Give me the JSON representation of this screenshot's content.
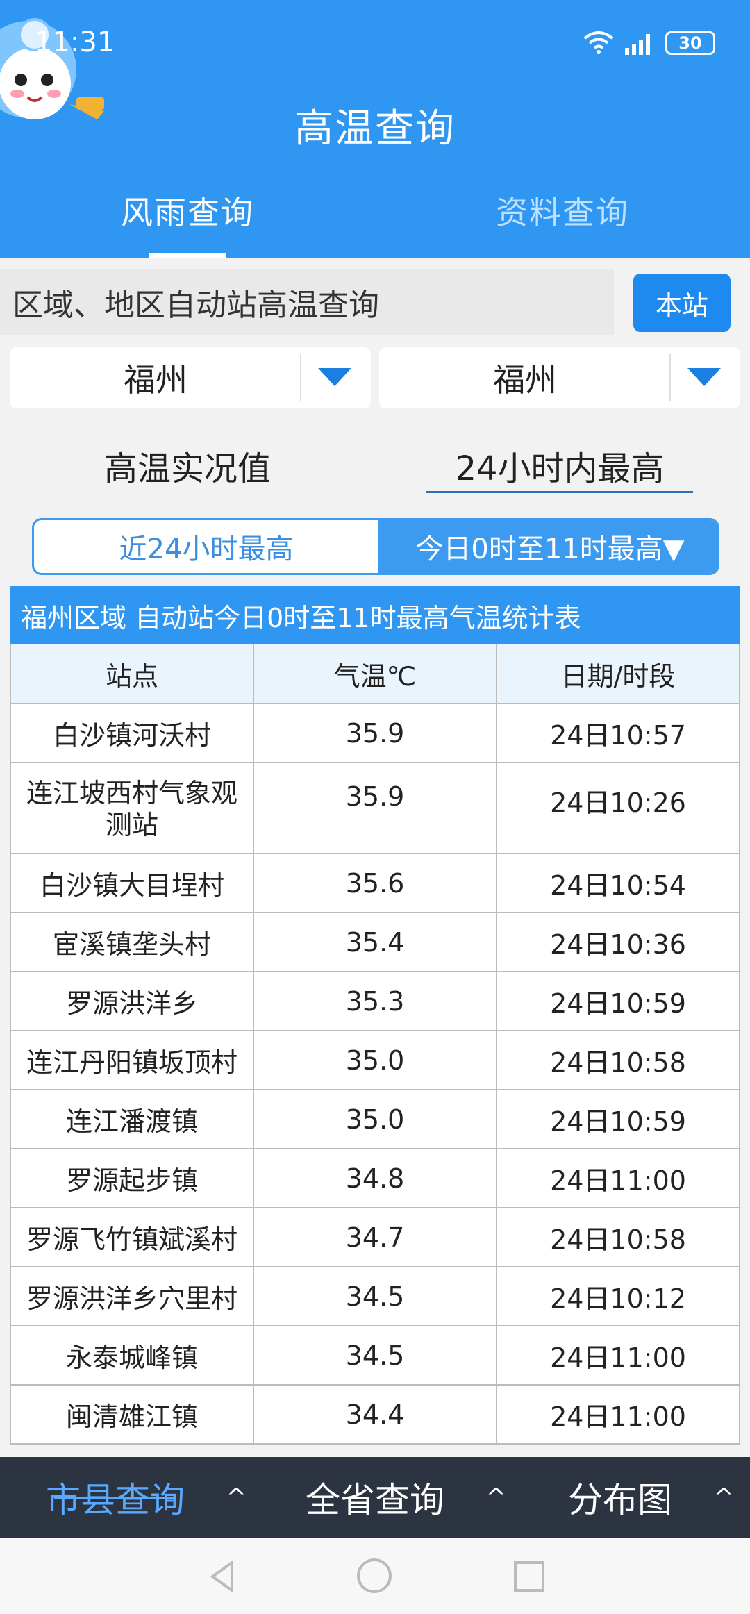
{
  "status": {
    "time": "11:31",
    "battery": "30"
  },
  "app": {
    "title": "高温查询"
  },
  "tabs": {
    "left": "风雨查询",
    "right": "资料查询"
  },
  "search": {
    "label": "区域、地区自动站高温查询",
    "button": "本站"
  },
  "selects": {
    "left": "福州",
    "right": "福州"
  },
  "modes": {
    "left": "高温实况值",
    "right": "24小时内最高"
  },
  "segment": {
    "left": "近24小时最高",
    "right": "今日0时至11时最高▼"
  },
  "table": {
    "title": "福州区域 自动站今日0时至11时最高气温统计表",
    "headers": [
      "站点",
      "气温℃",
      "日期/时段"
    ],
    "rows": [
      [
        "白沙镇河沃村",
        "35.9",
        "24日10:57"
      ],
      [
        "连江坡西村气象观测站",
        "35.9",
        "24日10:26"
      ],
      [
        "白沙镇大目埕村",
        "35.6",
        "24日10:54"
      ],
      [
        "宦溪镇垄头村",
        "35.4",
        "24日10:36"
      ],
      [
        "罗源洪洋乡",
        "35.3",
        "24日10:59"
      ],
      [
        "连江丹阳镇坂顶村",
        "35.0",
        "24日10:58"
      ],
      [
        "连江潘渡镇",
        "35.0",
        "24日10:59"
      ],
      [
        "罗源起步镇",
        "34.8",
        "24日11:00"
      ],
      [
        "罗源飞竹镇斌溪村",
        "34.7",
        "24日10:58"
      ],
      [
        "罗源洪洋乡穴里村",
        "34.5",
        "24日10:12"
      ],
      [
        "永泰城峰镇",
        "34.5",
        "24日11:00"
      ],
      [
        "闽清雄江镇",
        "34.4",
        "24日11:00"
      ]
    ]
  },
  "bottom_nav": {
    "item1": "市县查询",
    "item2": "全省查询",
    "item3": "分布图"
  }
}
